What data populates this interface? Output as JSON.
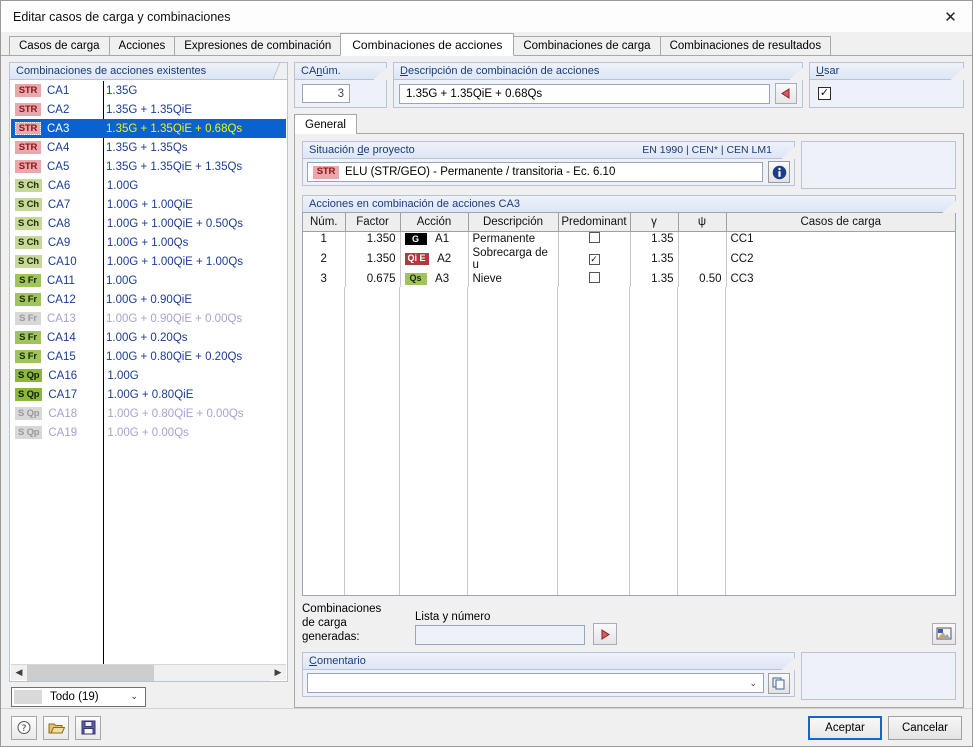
{
  "window": {
    "title": "Editar casos de carga y combinaciones",
    "close_icon": "close-icon"
  },
  "tabs": [
    {
      "label": "Casos de carga",
      "active": false
    },
    {
      "label": "Acciones",
      "active": false
    },
    {
      "label": "Expresiones de combinación",
      "active": false
    },
    {
      "label": "Combinaciones de acciones",
      "active": true
    },
    {
      "label": "Combinaciones de carga",
      "active": false
    },
    {
      "label": "Combinaciones de resultados",
      "active": false
    }
  ],
  "left_panel": {
    "title": "Combinaciones de acciones existentes",
    "rows": [
      {
        "badge": "STR",
        "badge_kind": "str",
        "id": "CA1",
        "expr": "1.35G",
        "selected": false,
        "dim": false
      },
      {
        "badge": "STR",
        "badge_kind": "str",
        "id": "CA2",
        "expr": "1.35G + 1.35QiE",
        "selected": false,
        "dim": false
      },
      {
        "badge": "STR",
        "badge_kind": "str",
        "id": "CA3",
        "expr": "1.35G + 1.35QiE + 0.68Qs",
        "selected": true,
        "dim": false
      },
      {
        "badge": "STR",
        "badge_kind": "str",
        "id": "CA4",
        "expr": "1.35G + 1.35Qs",
        "selected": false,
        "dim": false
      },
      {
        "badge": "STR",
        "badge_kind": "str",
        "id": "CA5",
        "expr": "1.35G + 1.35QiE + 1.35Qs",
        "selected": false,
        "dim": false
      },
      {
        "badge": "S Ch",
        "badge_kind": "sch",
        "id": "CA6",
        "expr": "1.00G",
        "selected": false,
        "dim": false
      },
      {
        "badge": "S Ch",
        "badge_kind": "sch",
        "id": "CA7",
        "expr": "1.00G + 1.00QiE",
        "selected": false,
        "dim": false
      },
      {
        "badge": "S Ch",
        "badge_kind": "sch",
        "id": "CA8",
        "expr": "1.00G + 1.00QiE + 0.50Qs",
        "selected": false,
        "dim": false
      },
      {
        "badge": "S Ch",
        "badge_kind": "sch",
        "id": "CA9",
        "expr": "1.00G + 1.00Qs",
        "selected": false,
        "dim": false
      },
      {
        "badge": "S Ch",
        "badge_kind": "sch",
        "id": "CA10",
        "expr": "1.00G + 1.00QiE + 1.00Qs",
        "selected": false,
        "dim": false
      },
      {
        "badge": "S Fr",
        "badge_kind": "sfr",
        "id": "CA11",
        "expr": "1.00G",
        "selected": false,
        "dim": false
      },
      {
        "badge": "S Fr",
        "badge_kind": "sfr",
        "id": "CA12",
        "expr": "1.00G + 0.90QiE",
        "selected": false,
        "dim": false
      },
      {
        "badge": "S Fr",
        "badge_kind": "gray",
        "id": "CA13",
        "expr": "1.00G + 0.90QiE + 0.00Qs",
        "selected": false,
        "dim": true
      },
      {
        "badge": "S Fr",
        "badge_kind": "sfr",
        "id": "CA14",
        "expr": "1.00G + 0.20Qs",
        "selected": false,
        "dim": false
      },
      {
        "badge": "S Fr",
        "badge_kind": "sfr",
        "id": "CA15",
        "expr": "1.00G + 0.80QiE + 0.20Qs",
        "selected": false,
        "dim": false
      },
      {
        "badge": "S Qp",
        "badge_kind": "sqp",
        "id": "CA16",
        "expr": "1.00G",
        "selected": false,
        "dim": false
      },
      {
        "badge": "S Qp",
        "badge_kind": "sqp",
        "id": "CA17",
        "expr": "1.00G + 0.80QiE",
        "selected": false,
        "dim": false
      },
      {
        "badge": "S Qp",
        "badge_kind": "gray",
        "id": "CA18",
        "expr": "1.00G + 0.80QiE + 0.00Qs",
        "selected": false,
        "dim": true
      },
      {
        "badge": "S Qp",
        "badge_kind": "gray",
        "id": "CA19",
        "expr": "1.00G + 0.00Qs",
        "selected": false,
        "dim": true
      }
    ],
    "filter_label": "Todo (19)",
    "scroll_left_icon": "chevron-left-icon",
    "scroll_right_icon": "chevron-right-icon",
    "dropdown_icon": "chevron-down-icon"
  },
  "ca_number": {
    "title": "CA núm.",
    "title_prefix": "CA ",
    "title_underlined": "n",
    "title_suffix": "úm.",
    "value": "3"
  },
  "description": {
    "title_first": "D",
    "title_rest": "escripción de combinación de acciones",
    "value": "1.35G + 1.35QiE + 0.68Qs",
    "apply_icon": "arrow-left-icon"
  },
  "usar": {
    "title_first": "U",
    "title_rest": "sar",
    "checked": true,
    "check_glyph": "✓"
  },
  "inner_tab": {
    "label": "General"
  },
  "design_situation": {
    "title_prefix": "Situación ",
    "title_underlined": "d",
    "title_suffix": "e proyecto",
    "standard_note": "EN 1990 | CEN* | CEN LM1",
    "badge": "STR",
    "value": "ELU (STR/GEO) - Permanente / transitoria - Ec. 6.10",
    "info_icon": "info-icon"
  },
  "actions_table": {
    "title": "Acciones en combinación de acciones CA3",
    "columns": [
      "Núm.",
      "Factor",
      "Acción",
      "Descripción",
      "Predominant",
      "γ",
      "ψ",
      "Casos de carga"
    ],
    "rows": [
      {
        "num": "1",
        "factor": "1.350",
        "action_badge": "G",
        "action_badge_kind": "mb-g",
        "action_id": "A1",
        "descripcion": "Permanente",
        "predominant": false,
        "gamma": "1.35",
        "psi": "",
        "casos": "CC1"
      },
      {
        "num": "2",
        "factor": "1.350",
        "action_badge": "Qi E",
        "action_badge_kind": "mb-qie",
        "action_id": "A2",
        "descripcion": "Sobrecarga de u",
        "predominant": true,
        "gamma": "1.35",
        "psi": "",
        "casos": "CC2"
      },
      {
        "num": "3",
        "factor": "0.675",
        "action_badge": "Qs",
        "action_badge_kind": "mb-qs",
        "action_id": "A3",
        "descripcion": "Nieve",
        "predominant": false,
        "gamma": "1.35",
        "psi": "0.50",
        "casos": "CC3"
      }
    ],
    "check_glyph": "✓"
  },
  "generated": {
    "label_line1": "Combinaciones",
    "label_line2": "de carga generadas:",
    "field_caption": "Lista y número",
    "field_value": "",
    "go_icon": "play-arrow-icon",
    "export_icon": "image-export-icon"
  },
  "comment": {
    "title_first": "C",
    "title_rest": "omentario",
    "value": "",
    "dropdown_icon": "chevron-down-icon",
    "copy_icon": "copy-icon"
  },
  "footer": {
    "help_icon": "help-icon",
    "open_icon": "folder-open-icon",
    "save_icon": "save-icon",
    "accept_label": "Aceptar",
    "cancel_label": "Cancelar"
  }
}
